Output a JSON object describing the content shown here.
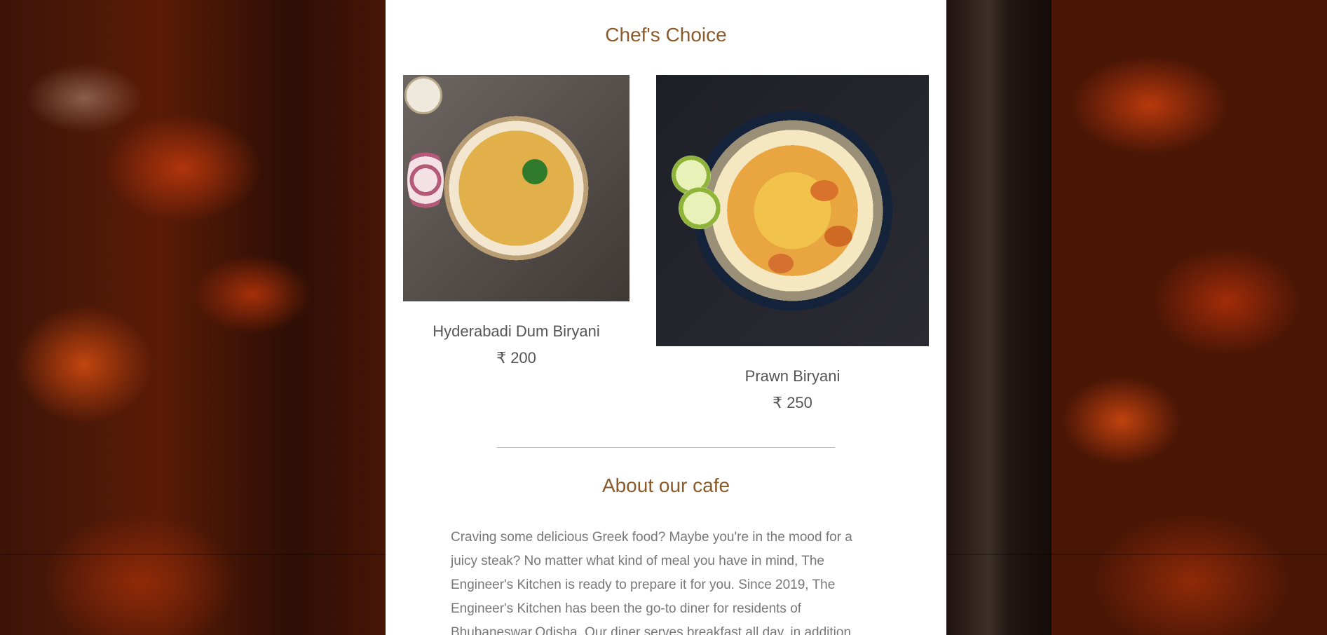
{
  "chefs_choice": {
    "title": "Chef's Choice",
    "items": [
      {
        "name": "Hyderabadi Dum Biryani",
        "price": "₹ 200"
      },
      {
        "name": "Prawn Biryani",
        "price": "₹ 250"
      }
    ]
  },
  "about": {
    "title": "About our cafe",
    "text": "Craving some delicious Greek food? Maybe you're in the mood for a juicy steak? No matter what kind of meal you have in mind, The Engineer's Kitchen is ready to prepare it for you. Since 2019, The Engineer's Kitchen has been the go-to diner for residents of Bhubaneswar,Odisha. Our diner serves breakfast all day, in addition"
  },
  "colors": {
    "heading": "#8b5a2b",
    "body_text": "#777777",
    "panel_bg": "#ffffff"
  }
}
